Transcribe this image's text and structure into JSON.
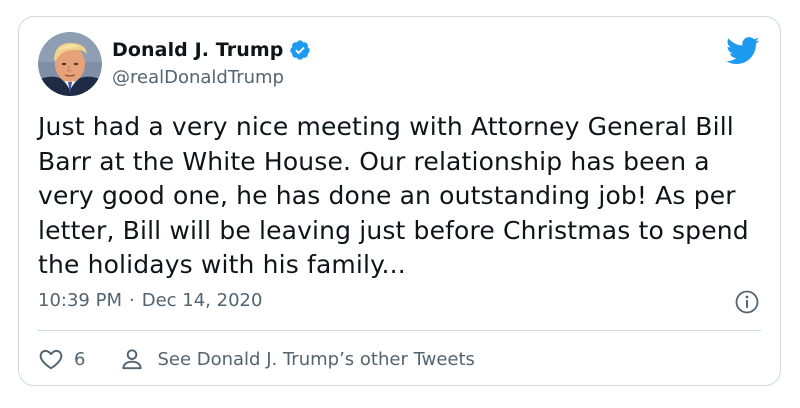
{
  "user": {
    "display_name": "Donald J. Trump",
    "handle": "@realDonaldTrump",
    "verified": true,
    "avatar_icon": "profile-photo"
  },
  "tweet": {
    "text": "Just had a very nice meeting with Attorney General Bill Barr at the White House. Our relationship has been a very good one, he has done an outstanding job! As per letter, Bill will be leaving just before Christmas to spend the holidays with his family...",
    "time": "10:39 PM",
    "separator": "·",
    "date": "Dec 14, 2020"
  },
  "actions": {
    "like_count": "6",
    "other_tweets_label": "See Donald J. Trump’s other Tweets"
  },
  "colors": {
    "brand_blue": "#1d9bf0",
    "text_primary": "#0f1419",
    "text_secondary": "#536471",
    "border": "#cfd9de"
  },
  "icons": {
    "brand": "twitter-bird-icon",
    "verified": "verified-badge-icon",
    "info": "info-icon",
    "like": "heart-icon",
    "profile": "person-icon"
  }
}
